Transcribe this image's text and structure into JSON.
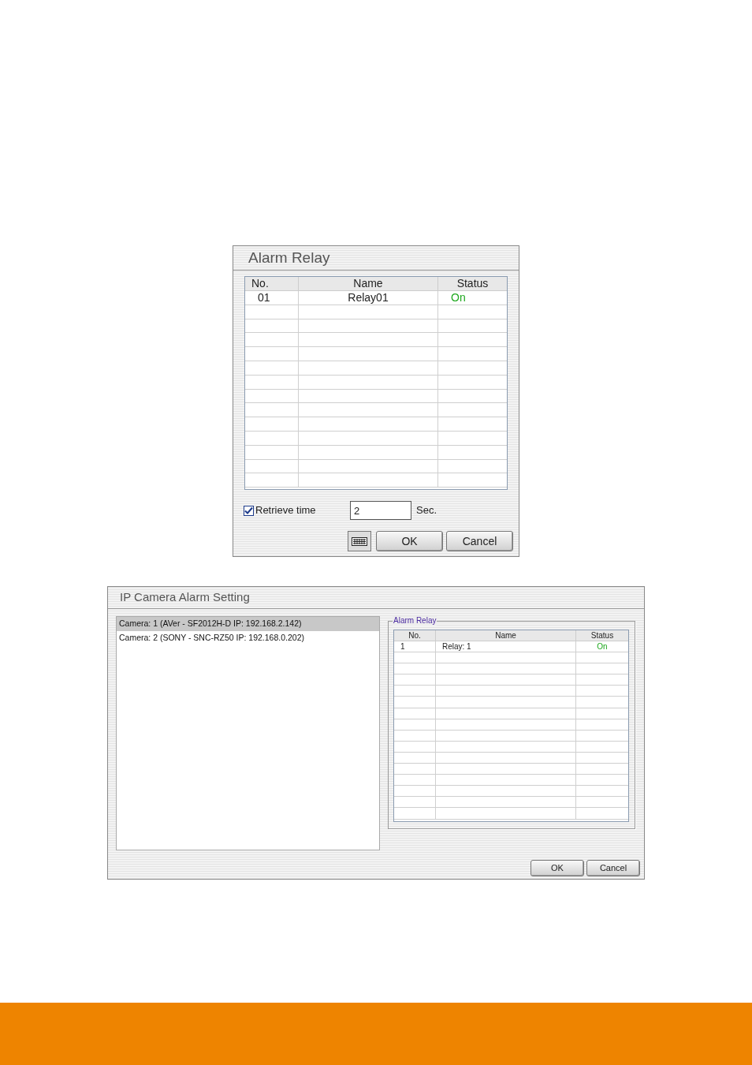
{
  "alarm_relay_dialog": {
    "title": "Alarm Relay",
    "table": {
      "columns": [
        "No.",
        "Name",
        "Status"
      ],
      "rows": [
        {
          "no": "01",
          "name": "Relay01",
          "status": "On",
          "on": true
        }
      ]
    },
    "retrieve_time": {
      "label": "Retrieve time",
      "checked": true,
      "value": "2",
      "unit": "Sec."
    },
    "buttons": [
      "OK",
      "Cancel"
    ]
  },
  "ip_camera_dialog": {
    "title": "IP Camera Alarm Setting",
    "cameras": [
      {
        "label": "Camera: 1 (AVer - SF2012H-D IP: 192.168.2.142)",
        "selected": true
      },
      {
        "label": "Camera: 2 (SONY - SNC-RZ50 IP: 192.168.0.202)",
        "selected": false
      }
    ],
    "group_title": "Alarm Relay",
    "table": {
      "columns": [
        "No.",
        "Name",
        "Status"
      ],
      "rows": [
        {
          "no": "1",
          "name": "Relay: 1",
          "status": "On",
          "on": true
        }
      ]
    },
    "buttons": [
      "OK",
      "Cancel"
    ]
  }
}
